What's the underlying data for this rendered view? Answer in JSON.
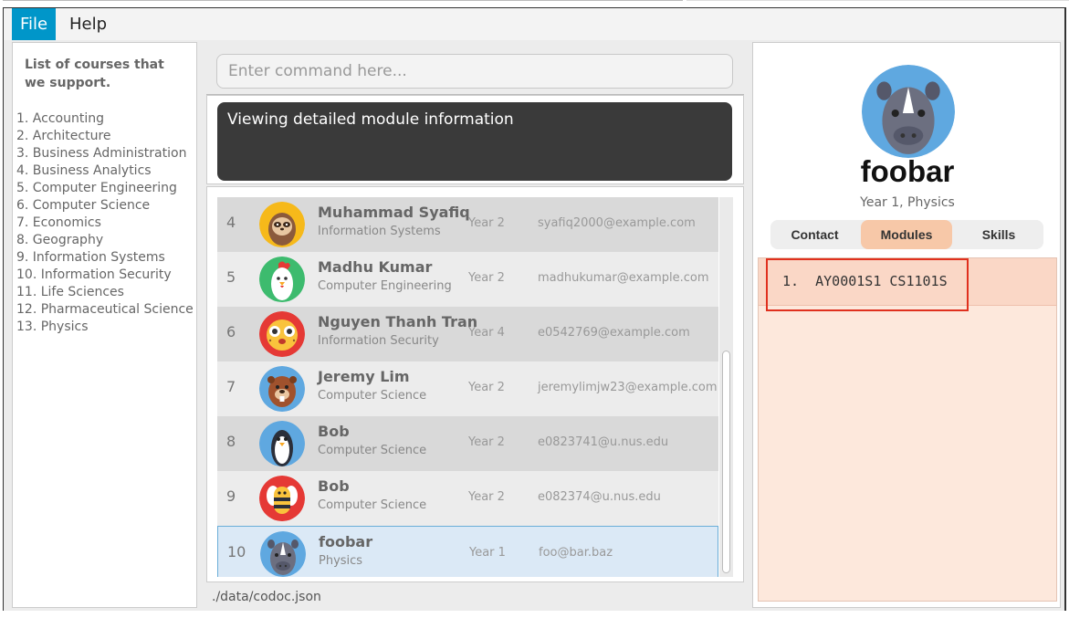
{
  "menu": {
    "file": "File",
    "help": "Help"
  },
  "courses_panel": {
    "title": "List of courses that we support.",
    "items": [
      "1. Accounting",
      "2. Architecture",
      "3. Business Administration",
      "4. Business Analytics",
      "5. Computer Engineering",
      "6. Computer Science",
      "7. Economics",
      "8. Geography",
      "9. Information Systems",
      "10. Information Security",
      "11. Life Sciences",
      "12. Pharmaceutical Science",
      "13. Physics"
    ]
  },
  "command": {
    "placeholder": "Enter command here..."
  },
  "result": {
    "text": "Viewing detailed module information"
  },
  "people": [
    {
      "index": "4",
      "name": "Muhammad Syafiq",
      "course": "Information Systems",
      "year": "Year 2",
      "email": "syafiq2000@example.com",
      "avatar": "sloth-icon",
      "selected": false
    },
    {
      "index": "5",
      "name": "Madhu Kumar",
      "course": "Computer Engineering",
      "year": "Year 2",
      "email": "madhukumar@example.com",
      "avatar": "chicken-icon",
      "selected": false
    },
    {
      "index": "6",
      "name": "Nguyen Thanh Tran",
      "course": "Information Security",
      "year": "Year 4",
      "email": "e0542769@example.com",
      "avatar": "pufferfish-icon",
      "selected": false
    },
    {
      "index": "7",
      "name": "Jeremy Lim",
      "course": "Computer Science",
      "year": "Year 2",
      "email": "jeremylimjw23@example.com",
      "avatar": "beaver-icon",
      "selected": false
    },
    {
      "index": "8",
      "name": "Bob",
      "course": "Computer Science",
      "year": "Year 2",
      "email": "e0823741@u.nus.edu",
      "avatar": "penguin-icon",
      "selected": false
    },
    {
      "index": "9",
      "name": "Bob",
      "course": "Computer Science",
      "year": "Year 2",
      "email": "e082374@u.nus.edu",
      "avatar": "bee-icon",
      "selected": false
    },
    {
      "index": "10",
      "name": "foobar",
      "course": "Physics",
      "year": "Year 1",
      "email": "foo@bar.baz",
      "avatar": "rhino-icon",
      "selected": true
    }
  ],
  "status_bar": {
    "path": "./data/codoc.json"
  },
  "profile": {
    "name": "foobar",
    "subtitle": "Year 1, Physics",
    "avatar": "rhino-icon",
    "tabs": [
      "Contact",
      "Modules",
      "Skills"
    ],
    "active_tab": "Modules",
    "modules": [
      "1.  AY0001S1 CS1101S"
    ]
  },
  "colors": {
    "menu_active": "#0096c9",
    "result_bg": "#3a3a3a",
    "selected_row": "#dbe9f6",
    "active_tab": "#f7c8a8",
    "module_bg": "#fde8dc",
    "highlight": "#e0301e"
  }
}
